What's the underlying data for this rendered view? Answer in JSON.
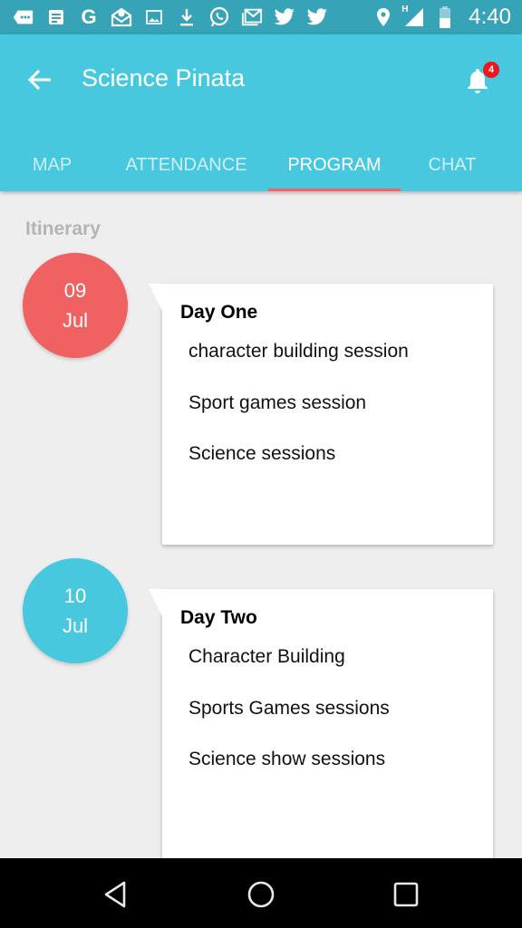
{
  "status_bar": {
    "icons": [
      "chat-bubble-icon",
      "notes-icon",
      "google-icon",
      "email-open-icon",
      "image-icon",
      "download-icon",
      "whatsapp-icon",
      "gmail-icon",
      "twitter-icon",
      "twitter-icon",
      "location-icon",
      "signal-icon",
      "battery-icon"
    ],
    "network_label": "H",
    "time": "4:40"
  },
  "appbar": {
    "title": "Science Pinata",
    "notification_count": "4",
    "color": "#48c8df"
  },
  "tabs": [
    {
      "label": "MAP",
      "active": false
    },
    {
      "label": "ATTENDANCE",
      "active": false
    },
    {
      "label": "PROGRAM",
      "active": true
    },
    {
      "label": "CHAT",
      "active": false
    }
  ],
  "itinerary": {
    "label": "Itinerary",
    "days": [
      {
        "day_num": "09",
        "month": "Jul",
        "circle_color": "#f06262",
        "title": "Day One",
        "items": [
          "character building session",
          "Sport games session",
          "Science sessions"
        ]
      },
      {
        "day_num": "10",
        "month": "Jul",
        "circle_color": "#48c8df",
        "title": "Day Two",
        "items": [
          "Character Building",
          "Sports Games sessions",
          "Science show sessions"
        ]
      }
    ]
  },
  "navbar": {
    "buttons": [
      "back",
      "home",
      "recents"
    ]
  }
}
